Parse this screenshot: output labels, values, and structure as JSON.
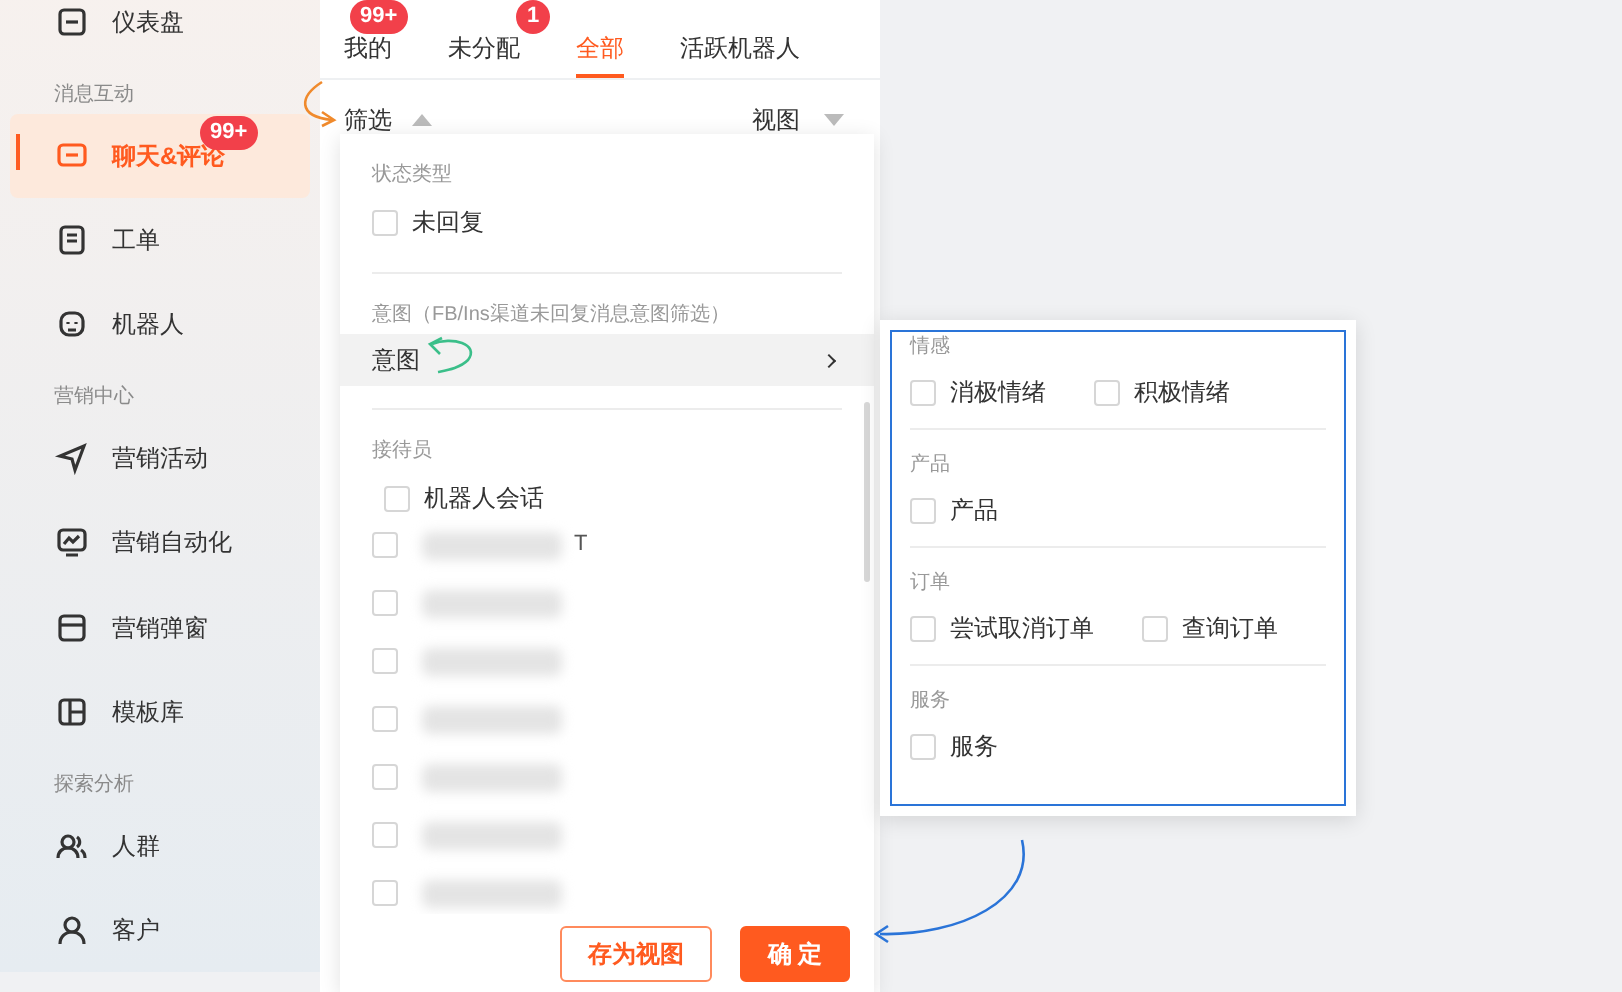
{
  "sidebar": {
    "items": [
      {
        "kind": "item",
        "label": "仪表盘",
        "selected": false
      },
      {
        "kind": "section",
        "label": "消息互动"
      },
      {
        "kind": "item",
        "label": "聊天&评论",
        "selected": true,
        "badge": "99+"
      },
      {
        "kind": "item",
        "label": "工单",
        "selected": false
      },
      {
        "kind": "item",
        "label": "机器人",
        "selected": false
      },
      {
        "kind": "section",
        "label": "营销中心"
      },
      {
        "kind": "item",
        "label": "营销活动",
        "selected": false
      },
      {
        "kind": "item",
        "label": "营销自动化",
        "selected": false
      },
      {
        "kind": "item",
        "label": "营销弹窗",
        "selected": false
      },
      {
        "kind": "item",
        "label": "模板库",
        "selected": false
      },
      {
        "kind": "section",
        "label": "探索分析"
      },
      {
        "kind": "item",
        "label": "人群",
        "selected": false
      },
      {
        "kind": "item",
        "label": "客户",
        "selected": false
      }
    ]
  },
  "tabs": [
    {
      "label": "我的",
      "selected": false,
      "badge": "99+"
    },
    {
      "label": "未分配",
      "selected": false,
      "badge": "1"
    },
    {
      "label": "全部",
      "selected": true
    },
    {
      "label": "活跃机器人",
      "selected": false
    }
  ],
  "toolbar": {
    "filter": "筛选",
    "filter_expanded": true,
    "view": "视图"
  },
  "filter_panel": {
    "status": {
      "title": "状态类型",
      "options": [
        {
          "label": "未回复",
          "checked": false
        }
      ]
    },
    "intent": {
      "title": "意图（FB/Ins渠道未回复消息意图筛选）",
      "row": {
        "label": "意图",
        "expanded": true
      }
    },
    "agents": {
      "title": "接待员",
      "options": [
        {
          "label": "机器人会话",
          "checked": false
        }
      ],
      "redacted": [
        {
          "checked": false,
          "tail": "T"
        },
        {
          "checked": false
        },
        {
          "checked": false
        },
        {
          "checked": false
        },
        {
          "checked": false
        },
        {
          "checked": false
        },
        {
          "checked": false
        }
      ]
    },
    "buttons": [
      {
        "label": "存为视图",
        "kind": "secondary"
      },
      {
        "label": "确 定",
        "kind": "primary"
      }
    ]
  },
  "intent_menu": {
    "groups": [
      {
        "title": "情感",
        "options": [
          {
            "label": "消极情绪",
            "checked": false
          },
          {
            "label": "积极情绪",
            "checked": false
          }
        ]
      },
      {
        "title": "产品",
        "options": [
          {
            "label": "产品",
            "checked": false
          }
        ]
      },
      {
        "title": "订单",
        "options": [
          {
            "label": "尝试取消订单",
            "checked": false
          },
          {
            "label": "查询订单",
            "checked": false
          }
        ]
      },
      {
        "title": "服务",
        "options": [
          {
            "label": "服务",
            "checked": false
          }
        ]
      }
    ]
  }
}
